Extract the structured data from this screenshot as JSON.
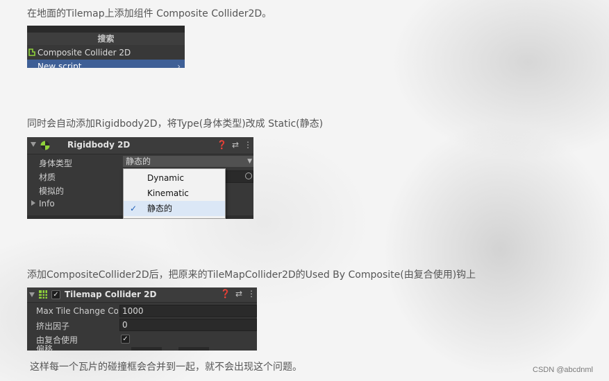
{
  "document": {
    "line1": "在地面的Tilemap上添加组件 Composite Collider2D。",
    "line2": "同时会自动添加Rigidbody2D，将Type(身体类型)改成 Static(静态)",
    "line3": "添加CompositeCollider2D后，把原来的TileMapCollider2D的Used By Composite(由复合使用)钩上",
    "line4": "这样每一个瓦片的碰撞框会合并到一起，就不会出现这个问题。",
    "watermark": "CSDN @abcdnml"
  },
  "search_panel": {
    "header": "搜索",
    "items": [
      {
        "label": "Composite Collider 2D",
        "icon": "polygon-collider-icon"
      },
      {
        "label": "New script",
        "icon": "chevron-right-icon",
        "highlighted": true
      }
    ],
    "highlight_color": "#3e5f96"
  },
  "rigidbody_panel": {
    "title": "Rigidbody 2D",
    "fields": [
      {
        "label": "身体类型",
        "value": "静态的"
      },
      {
        "label": "材质",
        "value": ""
      },
      {
        "label": "模拟的",
        "value": ""
      },
      {
        "label": "Info",
        "value": ""
      }
    ],
    "dropdown_options": [
      {
        "label": "Dynamic",
        "selected": false
      },
      {
        "label": "Kinematic",
        "selected": false
      },
      {
        "label": "静态的",
        "selected": true
      }
    ],
    "header_icons": [
      "help-icon",
      "preset-icon",
      "kebab-menu-icon"
    ]
  },
  "tilemap_panel": {
    "title": "Tilemap Collider 2D",
    "enabled": true,
    "fields": [
      {
        "label": "Max Tile Change Count",
        "value": "1000"
      },
      {
        "label": "挤出因子",
        "value": "0"
      },
      {
        "label": "由复合使用",
        "value": true
      },
      {
        "label": "偏移",
        "value": ""
      }
    ],
    "icon_color": "#8fd33a"
  }
}
